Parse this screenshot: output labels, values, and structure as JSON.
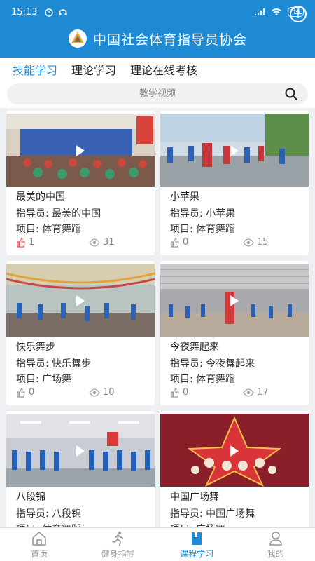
{
  "status": {
    "time": "15:13",
    "battery": "34"
  },
  "header": {
    "title": "中国社会体育指导员协会"
  },
  "tabs": [
    {
      "label": "技能学习",
      "active": true
    },
    {
      "label": "理论学习",
      "active": false
    },
    {
      "label": "理论在线考核",
      "active": false
    }
  ],
  "search": {
    "placeholder": "教学视频"
  },
  "colors": {
    "primary": "#1f8ad4",
    "like": "#e05050"
  },
  "cards": [
    {
      "title": "最美的中国",
      "instructor": "指导员: 最美的中国",
      "project": "项目: 体育舞蹈",
      "likes": "1",
      "views": "31",
      "liked": true
    },
    {
      "title": "小苹果",
      "instructor": "指导员: 小苹果",
      "project": "项目: 体育舞蹈",
      "likes": "0",
      "views": "15",
      "liked": false
    },
    {
      "title": "快乐舞步",
      "instructor": "指导员: 快乐舞步",
      "project": "项目: 广场舞",
      "likes": "0",
      "views": "10",
      "liked": false
    },
    {
      "title": "今夜舞起来",
      "instructor": "指导员: 今夜舞起来",
      "project": "项目: 体育舞蹈",
      "likes": "0",
      "views": "17",
      "liked": false
    },
    {
      "title": "八段锦",
      "instructor": "指导员: 八段锦",
      "project": "项目: 体育舞蹈",
      "likes": "",
      "views": "",
      "liked": false
    },
    {
      "title": "中国广场舞",
      "instructor": "指导员: 中国广场舞",
      "project": "项目: 广场舞",
      "likes": "",
      "views": "",
      "liked": false
    }
  ],
  "bottom_nav": [
    {
      "label": "首页",
      "icon": "home-icon",
      "active": false
    },
    {
      "label": "健身指导",
      "icon": "runner-icon",
      "active": false
    },
    {
      "label": "课程学习",
      "icon": "book-icon",
      "active": true
    },
    {
      "label": "我的",
      "icon": "user-icon",
      "active": false
    }
  ]
}
